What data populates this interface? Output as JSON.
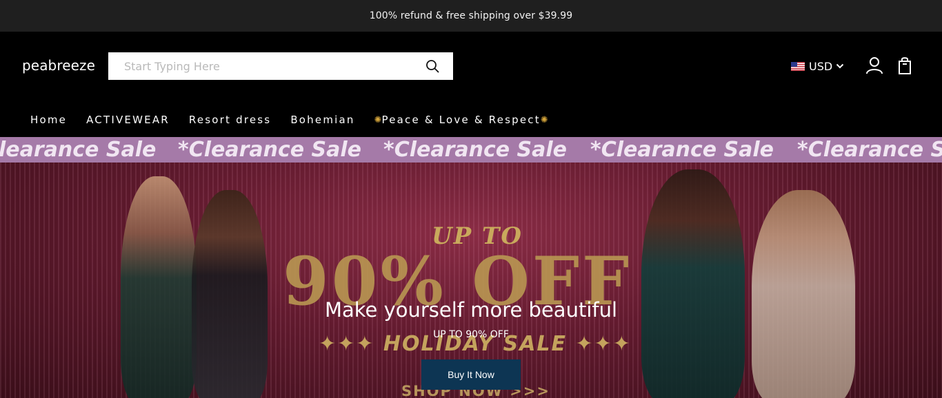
{
  "announcement": {
    "text": "100% refund & free shipping over $39.99"
  },
  "header": {
    "logo": "peabreeze",
    "search": {
      "placeholder": "Start Typing Here",
      "value": ""
    },
    "currency": {
      "label": "USD",
      "flag": "us-flag-icon"
    },
    "icons": [
      "search-icon",
      "chevron-down-icon",
      "account-icon",
      "cart-icon"
    ]
  },
  "nav": {
    "items": [
      {
        "label": "Home"
      },
      {
        "label": "ACTIVEWEAR"
      },
      {
        "label": "Resort dress"
      },
      {
        "label": "Bohemian"
      },
      {
        "label": "Peace & Love & Respect",
        "prefix_icon": "sunflower-icon",
        "suffix_icon": "sunflower-icon"
      }
    ]
  },
  "hero": {
    "marquee": {
      "items": [
        "learance Sale",
        "*Clearance Sale",
        "*Clearance Sale",
        "*Clearance Sale",
        "*Clearance Sale"
      ]
    },
    "banner": {
      "up_to": "UP TO",
      "big": "90% OFF",
      "holiday": "✦✦✦ HOLIDAY SALE ✦✦✦",
      "shop": "SHOP NOW >>>"
    },
    "headline": "Make yourself more beautiful",
    "subline": "UP TO 90% OFF",
    "cta_label": "Buy It Now"
  },
  "colors": {
    "announcement_bg": "#1f1f1f",
    "header_bg": "#000000",
    "marquee_bg": "#a57aa8",
    "cta_bg": "#0d3553",
    "gold": "#c4a35d"
  }
}
